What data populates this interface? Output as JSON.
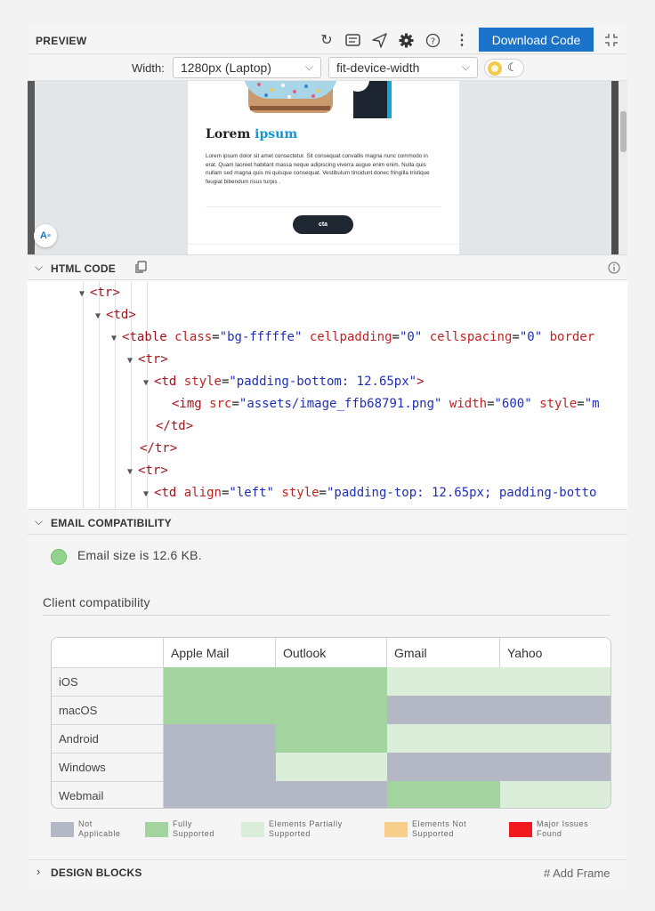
{
  "header": {
    "title": "PREVIEW",
    "download_label": "Download Code",
    "icons": [
      "refresh-icon",
      "list-icon",
      "send-icon",
      "gear-icon",
      "help-icon",
      "more-icon",
      "collapse-icon"
    ]
  },
  "width_bar": {
    "label": "Width:",
    "device": "1280px (Laptop)",
    "mode": "fit-device-width"
  },
  "preview": {
    "title_part1": "Lorem ",
    "title_part2": "ipsum",
    "body": "Lorem ipsum dolor sit amet consectetur. Sit consequat convallis magna nunc commodo in erat. Quam laoreet habitant massa neque adipiscing viverra augue enim enim. Nulla quis nullam sed magna quis mi quisque consequat. Vestibulum tincidunt donec fringilla tristique feugiat bibendum risus turpis .",
    "cta": "cta",
    "ai_label": "A"
  },
  "html_code": {
    "title": "HTML CODE",
    "lines": {
      "l1": {
        "tag": "<tr>"
      },
      "l2": {
        "tag": "<td>"
      },
      "l3": {
        "tag": "<table",
        "a1": "class",
        "v1": "\"bg-fffffe\"",
        "a2": "cellpadding",
        "v2": "\"0\"",
        "a3": "cellspacing",
        "v3": "\"0\"",
        "a4": "border"
      },
      "l4": {
        "tag": "<tr>"
      },
      "l5": {
        "tag": "<td",
        "a1": "style",
        "v1": "\"padding-bottom: 12.65px\"",
        "end": ">"
      },
      "l6": {
        "tag": "<img",
        "a1": "src",
        "v1": "\"assets/image_ffb68791.png\"",
        "a2": "width",
        "v2": "\"600\"",
        "a3": "style",
        "v3": "\"m"
      },
      "l7": {
        "tag": "</td>"
      },
      "l8": {
        "tag": "</tr>"
      },
      "l9": {
        "tag": "<tr>"
      },
      "l10": {
        "tag": "<td",
        "a1": "align",
        "v1": "\"left\"",
        "a2": "style",
        "v2": "\"padding-top: 12.65px; padding-botto"
      }
    }
  },
  "compat": {
    "title": "EMAIL COMPATIBILITY",
    "size_text": "Email size is 12.6 KB.",
    "client_title": "Client compatibility",
    "columns": [
      "Apple Mail",
      "Outlook",
      "Gmail",
      "Yahoo"
    ],
    "rows": [
      {
        "name": "iOS",
        "status": [
          "full",
          "full",
          "partial",
          "partial"
        ]
      },
      {
        "name": "macOS",
        "status": [
          "full",
          "full",
          "na",
          "na"
        ]
      },
      {
        "name": "Android",
        "status": [
          "na",
          "full",
          "partial",
          "partial"
        ]
      },
      {
        "name": "Windows",
        "status": [
          "na",
          "partial",
          "na",
          "na"
        ]
      },
      {
        "name": "Webmail",
        "status": [
          "na",
          "na",
          "full",
          "partial"
        ]
      }
    ],
    "legend": [
      {
        "key": "na",
        "label": "Not\nApplicable",
        "color": "#b4b8c5"
      },
      {
        "key": "full",
        "label": "Fully\nSupported",
        "color": "#a3d4a0"
      },
      {
        "key": "partial",
        "label": "Elements Partially\nSupported",
        "color": "#dbeeda"
      },
      {
        "key": "notsup",
        "label": "Elements Not\nSupported",
        "color": "#f8cf8a"
      },
      {
        "key": "major",
        "label": "Major Issues\nFound",
        "color": "#f01a1f"
      }
    ]
  },
  "footer": {
    "title": "DESIGN BLOCKS",
    "add_frame": "# Add Frame"
  }
}
